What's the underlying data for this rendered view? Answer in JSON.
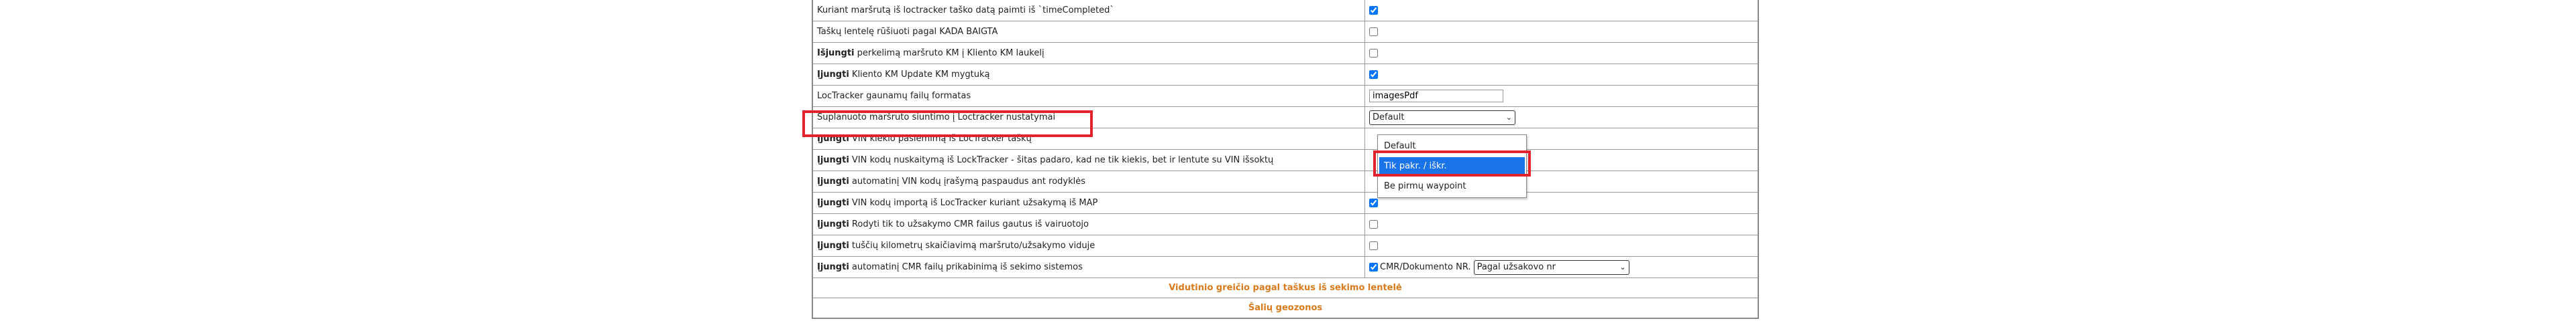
{
  "rows": [
    {
      "prefix": "",
      "label": "Kuriant maršrutą iš loctracker taško datą paimti iš `timeCompleted`",
      "control": "checkbox",
      "checked": true
    },
    {
      "prefix": "",
      "label": "Taškų lentelę rūšiuoti pagal KADA BAIGTA",
      "control": "checkbox",
      "checked": false
    },
    {
      "prefix": "Išjungti",
      "label": " perkelimą maršruto KM į Kliento KM laukelį",
      "control": "checkbox",
      "checked": false
    },
    {
      "prefix": "Įjungti",
      "label": " Kliento KM Update KM mygtuką",
      "control": "checkbox",
      "checked": true
    },
    {
      "prefix": "",
      "label": "LocTracker gaunamų failų formatas",
      "control": "text",
      "value": "imagesPdf"
    },
    {
      "prefix": "",
      "label": "Suplanuoto maršruto siuntimo į Loctracker nustatymai",
      "control": "select",
      "value": "Default"
    },
    {
      "prefix": "Įjungti",
      "label": " VIN kiekio pasiemimą iš LocTracker taškų",
      "control": "none"
    },
    {
      "prefix": "Įjungti",
      "label": " VIN kodų nuskaitymą iš LockTracker - šitas padaro, kad ne tik kiekis, bet ir lentute su VIN išsoktų",
      "control": "none"
    },
    {
      "prefix": "Įjungti",
      "label": " automatinį VIN kodų įrašymą paspaudus ant rodyklės",
      "control": "none"
    },
    {
      "prefix": "Įjungti",
      "label": " VIN kodų importą iš LocTracker kuriant užsakymą iš MAP",
      "control": "checkbox",
      "checked": true
    },
    {
      "prefix": "Įjungti",
      "label": " Rodyti tik to užsakymo CMR failus gautus iš vairuotojo",
      "control": "checkbox",
      "checked": false
    },
    {
      "prefix": "Įjungti",
      "label": " tuščių kilometrų skaičiavimą maršruto/užsakymo viduje",
      "control": "checkbox",
      "checked": false
    },
    {
      "prefix": "Įjungti",
      "label": " automatinį CMR failų prikabinimą iš sekimo sistemos",
      "control": "cmr",
      "checked": true,
      "cmr_label": "CMR/Dokumento NR.",
      "select_value": "Pagal užsakovo nr"
    }
  ],
  "section_headers": [
    "Vidutinio greičio pagal taškus iš sekimo lentelė",
    "Šalių geozonos"
  ],
  "dropdown": {
    "options": [
      "Default",
      "Tik pakr. / iškr.",
      "Be pirmų waypoint"
    ],
    "highlighted_index": 1
  },
  "colors": {
    "highlight_box": "#e2222c",
    "section_header": "#d97a1c",
    "option_selected": "#1a73e8"
  }
}
